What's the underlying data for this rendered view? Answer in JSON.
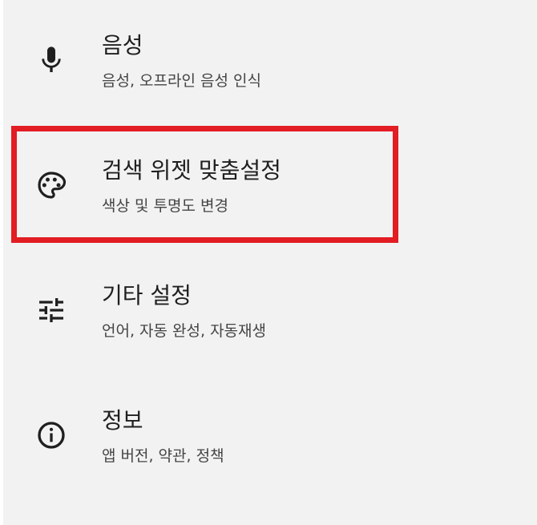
{
  "settings_items": [
    {
      "icon": "microphone-icon",
      "title": "음성",
      "subtitle": "음성, 오프라인 음성 인식"
    },
    {
      "icon": "palette-icon",
      "title": "검색 위젯 맞춤설정",
      "subtitle": "색상 및 투명도 변경"
    },
    {
      "icon": "tune-sliders-icon",
      "title": "기타 설정",
      "subtitle": "언어, 자동 완성, 자동재생"
    },
    {
      "icon": "info-icon",
      "title": "정보",
      "subtitle": "앱 버전, 약관, 정책"
    }
  ],
  "colors": {
    "background": "#f2f2f2",
    "text_primary": "#1f1f1f",
    "text_secondary": "#444444",
    "highlight_border": "#e21d23"
  }
}
